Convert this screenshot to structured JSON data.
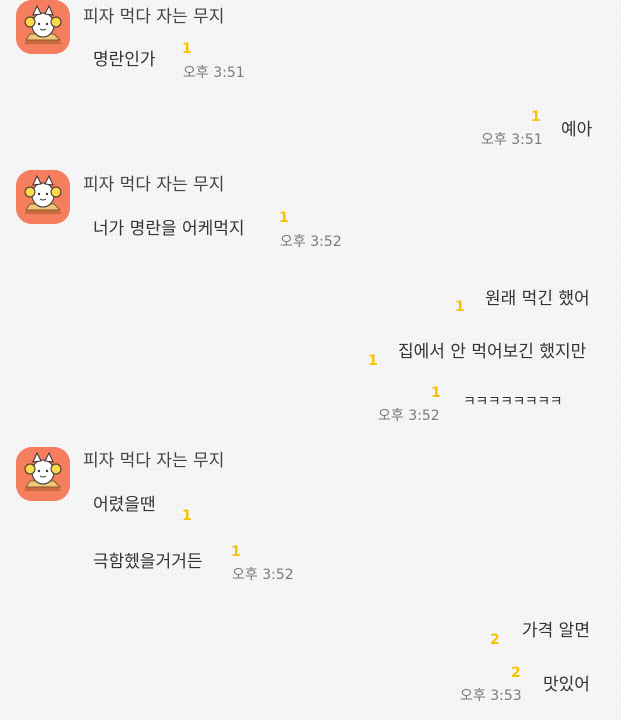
{
  "chat": {
    "sender_name": "피자 먹다 자는 무지",
    "messages": [
      {
        "side": "left",
        "text": "명란인가",
        "unread": "1",
        "time": "오후 3:51"
      },
      {
        "side": "right",
        "text": "예아",
        "unread": "1",
        "time": "오후 3:51"
      },
      {
        "side": "left",
        "text": "너가 명란을 어케먹지",
        "unread": "1",
        "time": "오후 3:52"
      },
      {
        "side": "right",
        "text": "원래 먹긴 했어",
        "unread": "1"
      },
      {
        "side": "right",
        "text": "집에서 안 먹어보긴 했지만",
        "unread": "1"
      },
      {
        "side": "right",
        "text": "ㅋㅋㅋㅋㅋㅋㅋㅋ",
        "unread": "1",
        "time": "오후 3:52"
      },
      {
        "side": "left",
        "text": "어렸을땐",
        "unread": "1"
      },
      {
        "side": "left",
        "text": "극함헸을거거든",
        "unread": "1",
        "time": "오후 3:52"
      },
      {
        "side": "right",
        "text": "가격 알면",
        "unread": "2"
      },
      {
        "side": "right",
        "text": "맛있어",
        "unread": "2",
        "time": "오후 3:53"
      }
    ]
  },
  "colors": {
    "background": "#f6f6f6",
    "avatar": "#f47e5e",
    "unread_count": "#f5c400",
    "timestamp": "#7a7a7a"
  },
  "icons": {
    "profile": "muzi-pizza-profile-icon"
  }
}
